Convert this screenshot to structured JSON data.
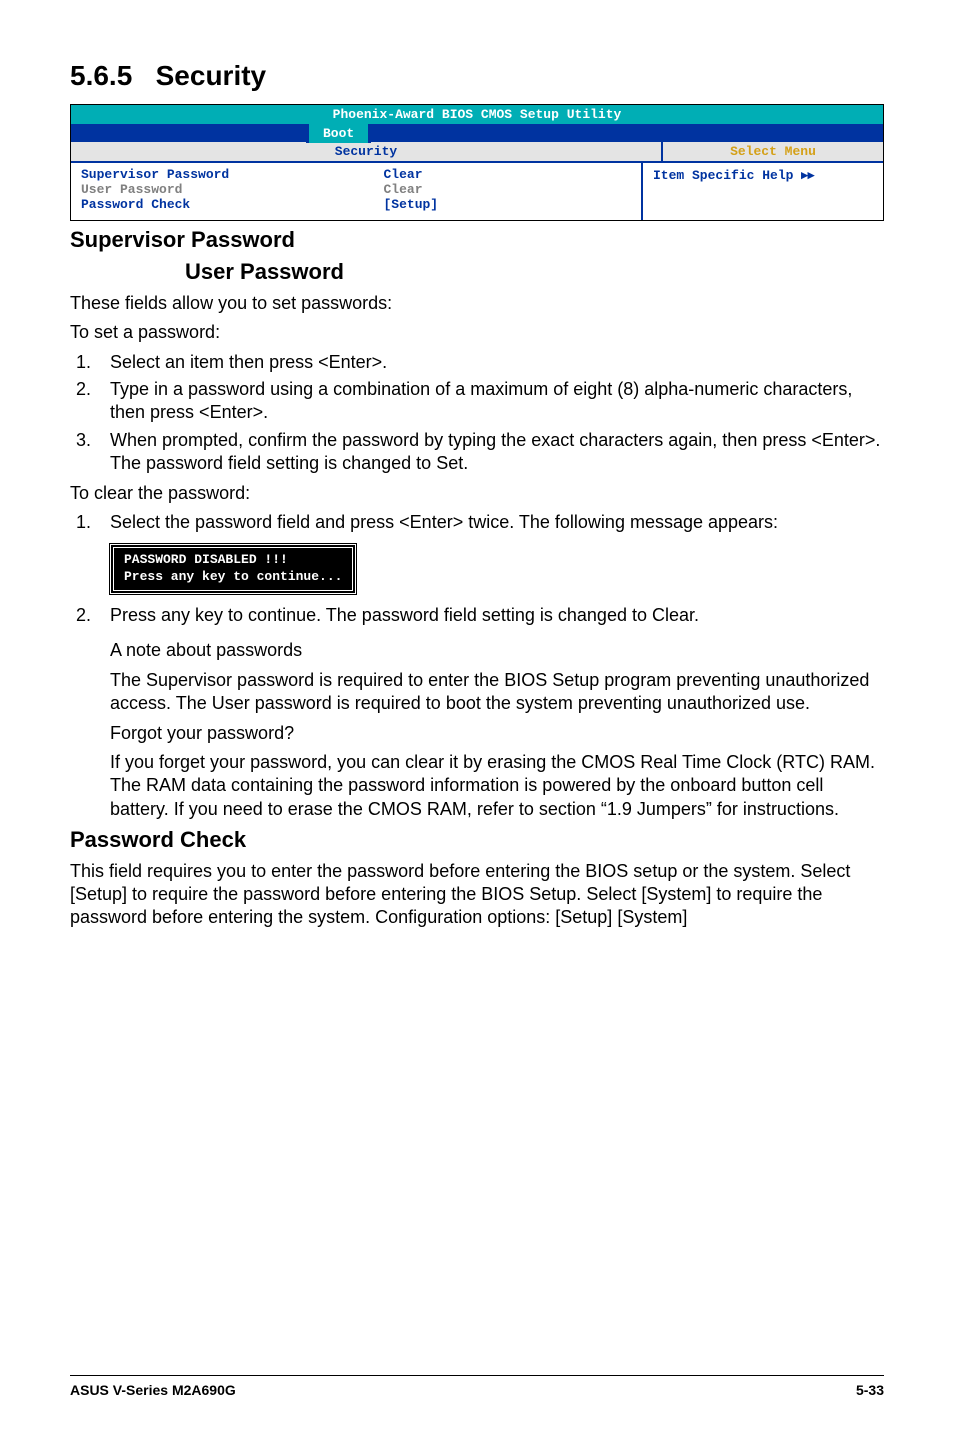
{
  "section_number": "5.6.5",
  "section_title": "Security",
  "bios": {
    "title": "Phoenix-Award BIOS CMOS Setup Utility",
    "active_tab": "Boot",
    "panel_title": "Security",
    "help_title": "Select Menu",
    "help_text": "Item Specific Help",
    "help_arrow": "▸▸",
    "rows": [
      {
        "label": "Supervisor Password",
        "value": "Clear",
        "style": "active"
      },
      {
        "label": "User Password",
        "value": "Clear",
        "style": "dim"
      },
      {
        "label": "Password Check",
        "value": "[Setup]",
        "style": "active"
      }
    ]
  },
  "h_supervisor": "Supervisor Password",
  "h_user": "User Password",
  "p_intro": "These fields allow you to set passwords:",
  "p_set": "To set a password:",
  "steps_set": [
    "Select an item then press <Enter>.",
    "Type in a password using a combination of a maximum of eight (8) alpha-numeric characters, then press <Enter>.",
    "When prompted, confirm the password by typing the exact characters again, then press <Enter>. The password field setting is changed to Set."
  ],
  "p_clear": "To clear the password:",
  "steps_clear1": "Select the password field and press <Enter> twice. The following message appears:",
  "msg_line1": "PASSWORD DISABLED !!!",
  "msg_line2": "Press any key to continue...",
  "steps_clear2": "Press any key to continue. The password field setting is changed to Clear.",
  "note_heading": "A note about passwords",
  "note_body": "The Supervisor password is required to enter the BIOS Setup program preventing unauthorized access. The User password is required to boot the system preventing unauthorized use.",
  "forgot_heading": "Forgot your password?",
  "forgot_body": "If you forget your password, you can clear it by erasing the CMOS Real Time Clock (RTC) RAM. The RAM data containing the password information is powered by the onboard button cell battery. If you need to erase the CMOS RAM, refer to section “1.9 Jumpers” for instructions.",
  "h_pwcheck": "Password Check",
  "pwcheck_body": "This field requires you to enter the password before entering the BIOS setup or the system. Select [Setup] to require the password before entering the BIOS Setup. Select [System] to require the password before entering the system. Configuration options: [Setup] [System]",
  "footer_left": "ASUS V-Series M2A690G",
  "footer_right": "5-33"
}
